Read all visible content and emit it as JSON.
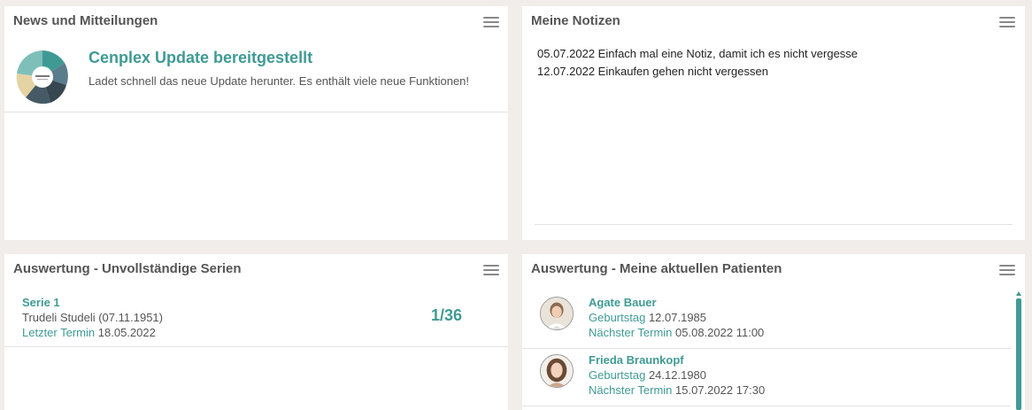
{
  "colors": {
    "accent": "#3f9a94",
    "background": "#f1edea"
  },
  "news": {
    "title": "News und Mitteilungen",
    "menu_icon": "hamburger-menu-icon",
    "items": [
      {
        "thumbnail_icon": "cenplex-pie-logo",
        "headline": "Cenplex Update bereitgestellt",
        "text": "Ladet schnell das neue Update herunter. Es enthält viele neue Funktionen!"
      }
    ]
  },
  "notes": {
    "title": "Meine Notizen",
    "menu_icon": "hamburger-menu-icon",
    "lines": [
      "05.07.2022 Einfach mal eine Notiz, damit ich es nicht vergesse",
      "12.07.2022 Einkaufen gehen nicht vergessen"
    ]
  },
  "series": {
    "title": "Auswertung - Unvollständige Serien",
    "menu_icon": "hamburger-menu-icon",
    "items": [
      {
        "name": "Serie 1",
        "patient": "Trudeli Studeli (07.11.1951)",
        "last_label": "Letzter Termin",
        "last_value": "18.05.2022",
        "count": "1/36"
      }
    ]
  },
  "patients": {
    "title": "Auswertung - Meine aktuellen Patienten",
    "menu_icon": "hamburger-menu-icon",
    "items": [
      {
        "name": "Agate Bauer",
        "birthday_label": "Geburtstag",
        "birthday": "12.07.1985",
        "next_label": "Nächster Termin",
        "next": "05.08.2022 11:00"
      },
      {
        "name": "Frieda Braunkopf",
        "birthday_label": "Geburtstag",
        "birthday": "24.12.1980",
        "next_label": "Nächster Termin",
        "next": "15.07.2022 17:30"
      }
    ]
  }
}
